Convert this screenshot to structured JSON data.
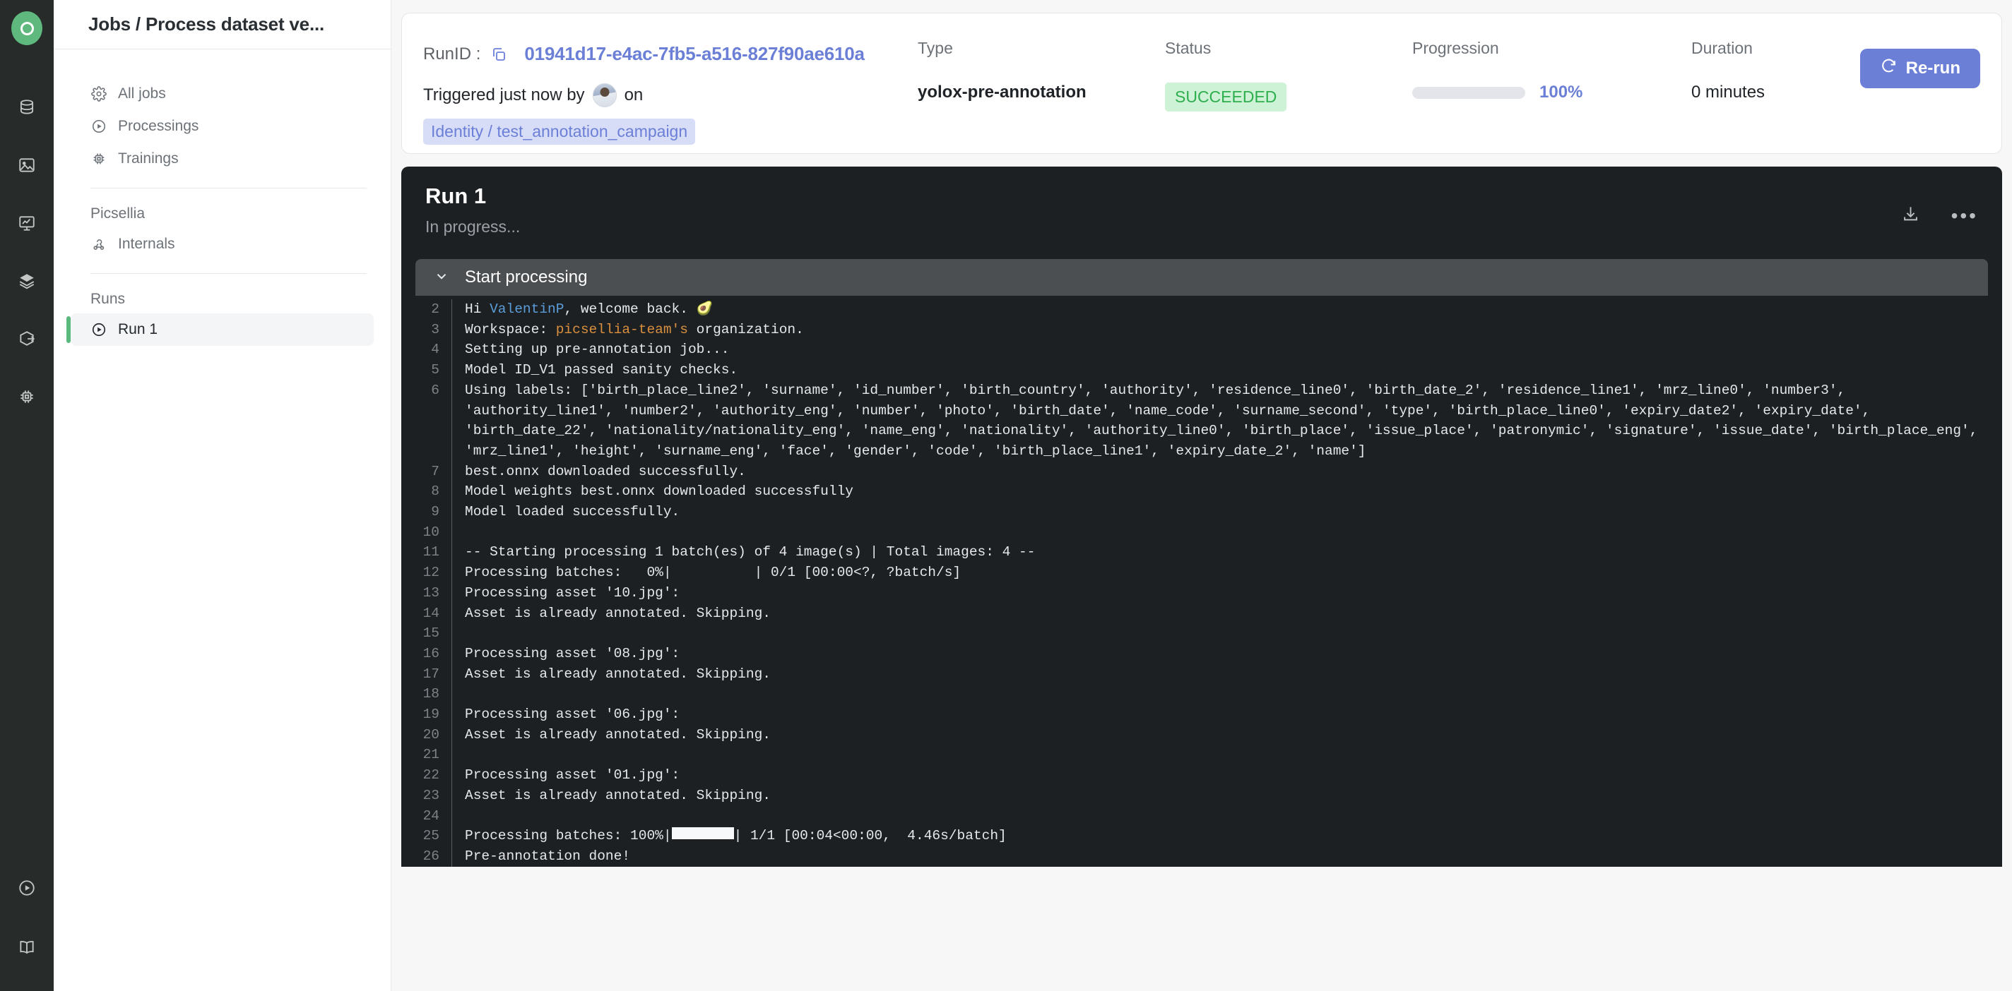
{
  "rail": {
    "logo_name": "picsellia-logo",
    "icons": [
      {
        "name": "database-icon"
      },
      {
        "name": "image-icon"
      },
      {
        "name": "experiment-chart-icon"
      },
      {
        "name": "layers-icon"
      },
      {
        "name": "deployment-box-icon"
      },
      {
        "name": "chip-icon"
      }
    ],
    "bottom_icons": [
      {
        "name": "play-circle-icon"
      },
      {
        "name": "book-docs-icon"
      }
    ]
  },
  "topbar": {
    "title": "Jobs / Process dataset ve..."
  },
  "sidebar": {
    "items": [
      {
        "label": "All jobs",
        "icon": "gear-icon",
        "active": false
      },
      {
        "label": "Processings",
        "icon": "play-circle-icon",
        "active": false
      },
      {
        "label": "Trainings",
        "icon": "chip-icon",
        "active": false
      }
    ],
    "group_picsellia": "Picsellia",
    "internals": {
      "label": "Internals",
      "icon": "webhook-icon"
    },
    "group_runs": "Runs",
    "runs": [
      {
        "label": "Run 1",
        "icon": "play-circle-icon",
        "active": true
      }
    ]
  },
  "info_card": {
    "runid_label": "RunID :",
    "copy_icon": "copy-icon",
    "runid_value": "01941d17-e4ac-7fb5-a516-827f90ae610a",
    "triggered_prefix": "Triggered just now by",
    "triggered_suffix": "on",
    "identity_chip": "Identity / test_annotation_campaign",
    "type_head": "Type",
    "type_value": "yolox-pre-annotation",
    "status_head": "Status",
    "status_value": "SUCCEEDED",
    "progression_head": "Progression",
    "progression_percent": "100%",
    "progression_value": 100,
    "duration_head": "Duration",
    "duration_value": "0 minutes",
    "rerun_label": "Re-run",
    "colors": {
      "accent": "#6b7fd7",
      "status_text": "#2fae4e",
      "status_bg": "#cdf2d5",
      "chip_bg": "#d8ddf7"
    }
  },
  "run_panel": {
    "title": "Run 1",
    "subtitle": "In progress...",
    "download_icon": "download-icon",
    "more_icon": "more-options-icon",
    "step_label": "Start processing",
    "step_chevron": "chevron-down-icon"
  },
  "log": {
    "lines": [
      {
        "n": "2",
        "segments": [
          {
            "t": "Hi "
          },
          {
            "t": "ValentinP",
            "c": "tok-blue"
          },
          {
            "t": ", welcome back. "
          },
          {
            "t": "🥑",
            "c": "avo"
          }
        ]
      },
      {
        "n": "3",
        "segments": [
          {
            "t": "Workspace: "
          },
          {
            "t": "picsellia-team's",
            "c": "tok-orange"
          },
          {
            "t": " organization."
          }
        ]
      },
      {
        "n": "4",
        "segments": [
          {
            "t": "Setting up pre-annotation job..."
          }
        ]
      },
      {
        "n": "5",
        "segments": [
          {
            "t": "Model ID_V1 passed sanity checks."
          }
        ]
      },
      {
        "n": "6",
        "wrap": true,
        "segments": [
          {
            "t": "Using labels: ['birth_place_line2', 'surname', 'id_number', 'birth_country', 'authority', 'residence_line0', 'birth_date_2', 'residence_line1', 'mrz_line0', 'number3', 'authority_line1', 'number2', 'authority_eng', 'number', 'photo', 'birth_date', 'name_code', 'surname_second', 'type', 'birth_place_line0', 'expiry_date2', 'expiry_date', 'birth_date_22', 'nationality/nationality_eng', 'name_eng', 'nationality', 'authority_line0', 'birth_place', 'issue_place', 'patronymic', 'signature', 'issue_date', 'birth_place_eng', 'mrz_line1', 'height', 'surname_eng', 'face', 'gender', 'code', 'birth_place_line1', 'expiry_date_2', 'name']"
          }
        ]
      },
      {
        "n": "7",
        "segments": [
          {
            "t": "best.onnx downloaded successfully."
          }
        ]
      },
      {
        "n": "8",
        "segments": [
          {
            "t": "Model weights best.onnx downloaded successfully"
          }
        ]
      },
      {
        "n": "9",
        "segments": [
          {
            "t": "Model loaded successfully."
          }
        ]
      },
      {
        "n": "10",
        "segments": [
          {
            "t": ""
          }
        ]
      },
      {
        "n": "11",
        "segments": [
          {
            "t": "-- Starting processing 1 batch(es) of 4 image(s) | Total images: 4 --"
          }
        ]
      },
      {
        "n": "12",
        "segments": [
          {
            "t": "Processing batches:   0%|          | 0/1 [00:00<?, ?batch/s]"
          }
        ]
      },
      {
        "n": "13",
        "segments": [
          {
            "t": "Processing asset '10.jpg':"
          }
        ]
      },
      {
        "n": "14",
        "segments": [
          {
            "t": "Asset is already annotated. Skipping."
          }
        ]
      },
      {
        "n": "15",
        "segments": [
          {
            "t": ""
          }
        ]
      },
      {
        "n": "16",
        "segments": [
          {
            "t": "Processing asset '08.jpg':"
          }
        ]
      },
      {
        "n": "17",
        "segments": [
          {
            "t": "Asset is already annotated. Skipping."
          }
        ]
      },
      {
        "n": "18",
        "segments": [
          {
            "t": ""
          }
        ]
      },
      {
        "n": "19",
        "segments": [
          {
            "t": "Processing asset '06.jpg':"
          }
        ]
      },
      {
        "n": "20",
        "segments": [
          {
            "t": "Asset is already annotated. Skipping."
          }
        ]
      },
      {
        "n": "21",
        "segments": [
          {
            "t": ""
          }
        ]
      },
      {
        "n": "22",
        "segments": [
          {
            "t": "Processing asset '01.jpg':"
          }
        ]
      },
      {
        "n": "23",
        "segments": [
          {
            "t": "Asset is already annotated. Skipping."
          }
        ]
      },
      {
        "n": "24",
        "segments": [
          {
            "t": ""
          }
        ]
      },
      {
        "n": "25",
        "segments": [
          {
            "t": "Processing batches: 100%|"
          },
          {
            "t": " ",
            "c": "pbar"
          },
          {
            "t": "| 1/1 [00:04<00:00,  4.46s/batch]"
          }
        ]
      },
      {
        "n": "26",
        "segments": [
          {
            "t": "Pre-annotation done!"
          }
        ]
      }
    ]
  }
}
